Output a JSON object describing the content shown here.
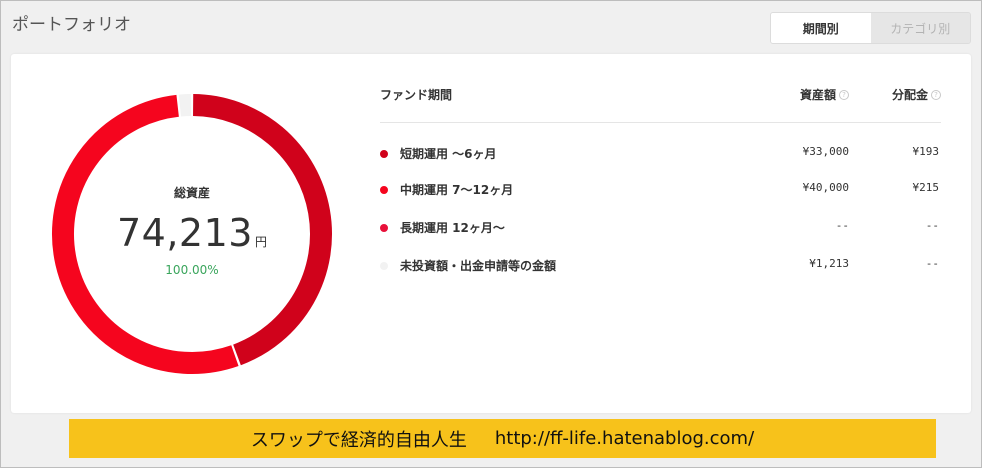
{
  "header": {
    "title": "ポートフォリオ"
  },
  "view_toggle": {
    "by_period": "期間別",
    "by_category": "カテゴリ別"
  },
  "summary": {
    "label": "総資産",
    "value": "74,213",
    "unit": "円",
    "percent": "100.00%"
  },
  "table": {
    "columns": {
      "fund_period": "ファンド期間",
      "assets": "資産額",
      "distribution": "分配金"
    },
    "rows": [
      {
        "name": "短期運用 ～6ヶ月",
        "assets": "¥33,000",
        "distribution": "¥193",
        "color": "#d0021b"
      },
      {
        "name": "中期運用 7～12ヶ月",
        "assets": "¥40,000",
        "distribution": "¥215",
        "color": "#f5051e"
      },
      {
        "name": "長期運用 12ヶ月～",
        "assets": "--",
        "distribution": "--",
        "color": "#e8103a"
      },
      {
        "name": "未投資額・出金申請等の金額",
        "assets": "¥1,213",
        "distribution": "--",
        "color": "#f2f2f2"
      }
    ]
  },
  "chart_data": {
    "type": "pie",
    "categories": [
      "短期運用 ～6ヶ月",
      "中期運用 7～12ヶ月",
      "長期運用 12ヶ月～",
      "未投資額・出金申請等の金額"
    ],
    "values": [
      33000,
      40000,
      0,
      1213
    ],
    "colors": [
      "#d0021b",
      "#f5051e",
      "#e8103a",
      "#f2f2f2"
    ]
  },
  "banner": {
    "text": "スワップで経済的自由人生",
    "url": "http://ff-life.hatenablog.com/"
  }
}
